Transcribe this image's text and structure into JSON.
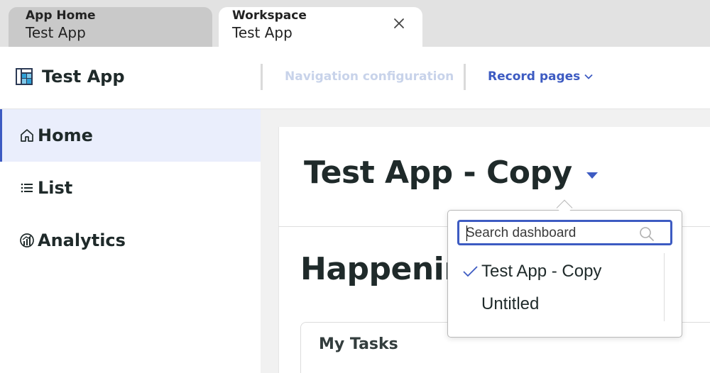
{
  "tabs": [
    {
      "sub": "App Home",
      "title": "Test App",
      "active": false
    },
    {
      "sub": "Workspace",
      "title": "Test App",
      "active": true
    }
  ],
  "header": {
    "app_name": "Test App",
    "nav_config": "Navigation configuration",
    "record_pages": "Record pages"
  },
  "sidebar": {
    "items": [
      {
        "label": "Home",
        "icon": "home-icon",
        "active": true
      },
      {
        "label": "List",
        "icon": "list-icon",
        "active": false
      },
      {
        "label": "Analytics",
        "icon": "analytics-icon",
        "active": false
      }
    ]
  },
  "dashboard": {
    "title": "Test App - Copy",
    "section_title": "Happening",
    "tasks_title": "My Tasks"
  },
  "dropdown": {
    "search_placeholder": "Search dashboard",
    "items": [
      {
        "label": "Test App - Copy",
        "selected": true
      },
      {
        "label": "Untitled",
        "selected": false
      }
    ]
  },
  "colors": {
    "accent": "#3d5bc2",
    "active_bg": "#eaeefc",
    "disabled_text": "#c8d3ea"
  }
}
